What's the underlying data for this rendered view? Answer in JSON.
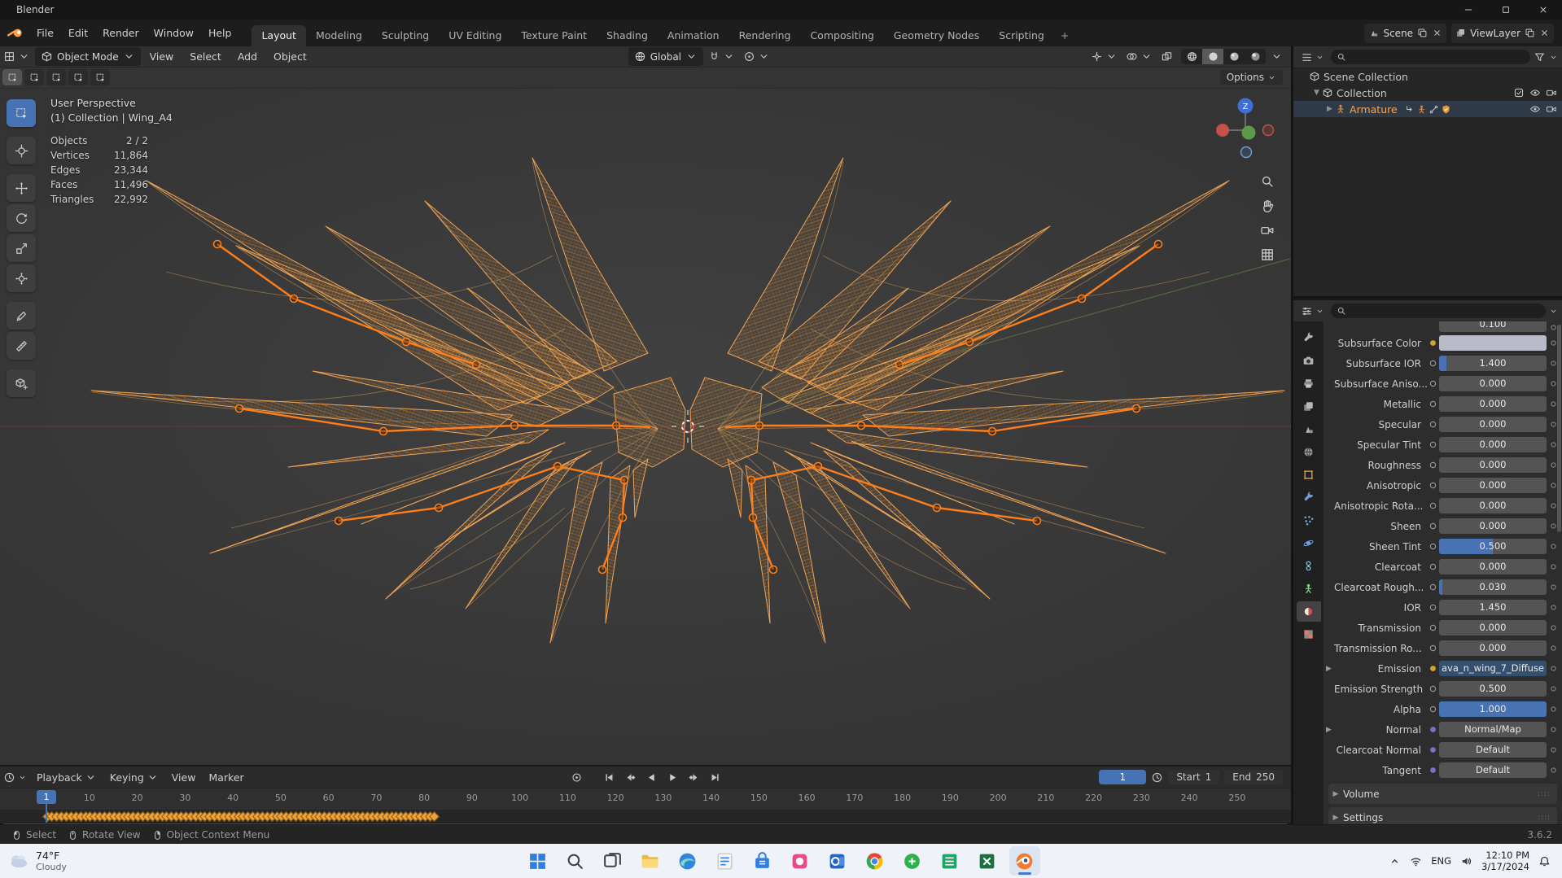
{
  "colors": {
    "accent_blue": "#4772b3",
    "selection_orange": "#e87d0d",
    "wing_orange": "#e8993f",
    "bone_orange": "#ff7e1a",
    "taskbar_bg": "#eff3f9"
  },
  "titlebar": {
    "title": "Blender"
  },
  "topbar": {
    "menus": [
      "File",
      "Edit",
      "Render",
      "Window",
      "Help"
    ],
    "tabs": [
      "Layout",
      "Modeling",
      "Sculpting",
      "UV Editing",
      "Texture Paint",
      "Shading",
      "Animation",
      "Rendering",
      "Compositing",
      "Geometry Nodes",
      "Scripting"
    ],
    "active_tab": "Layout",
    "add_tab": "+",
    "scene": {
      "label": "Scene"
    },
    "viewlayer": {
      "label": "ViewLayer"
    }
  },
  "viewport_header": {
    "mode": "Object Mode",
    "menus": [
      "View",
      "Select",
      "Add",
      "Object"
    ],
    "orientation": "Global"
  },
  "toolstrip": {
    "options_label": "Options"
  },
  "viewport_overlay": {
    "line1": "User Perspective",
    "line2": "(1) Collection | Wing_A4",
    "stats": [
      {
        "label": "Objects",
        "value": "2 / 2"
      },
      {
        "label": "Vertices",
        "value": "11,864"
      },
      {
        "label": "Edges",
        "value": "23,344"
      },
      {
        "label": "Faces",
        "value": "11,496"
      },
      {
        "label": "Triangles",
        "value": "22,992"
      }
    ],
    "gizmo_axis_label": "Z"
  },
  "tools": [
    "select-box",
    "cursor",
    "move",
    "rotate",
    "scale",
    "transform",
    "annotate",
    "measure",
    "add-cube"
  ],
  "outliner": {
    "rows": [
      {
        "label": "Scene Collection",
        "depth": 0,
        "icon": "box",
        "arrow": "",
        "inline": [],
        "right": []
      },
      {
        "label": "Collection",
        "depth": 1,
        "icon": "box",
        "arrow": "down",
        "inline": [],
        "right": [
          "checkbox",
          "eye",
          "camera"
        ]
      },
      {
        "label": "Armature",
        "depth": 2,
        "icon": "armature",
        "arrow": "right",
        "selected": true,
        "inline": [
          "childlink",
          "armature",
          "bone",
          "shield"
        ],
        "right": [
          "eye",
          "camera"
        ]
      }
    ]
  },
  "properties": {
    "partial_value": "0.100",
    "rows": [
      {
        "label": "Subsurface Color",
        "value": "",
        "type": "color",
        "socket": "yellow",
        "fill": 0
      },
      {
        "label": "Subsurface IOR",
        "value": "1.400",
        "type": "slider",
        "socket": "gray",
        "fill": 0.07
      },
      {
        "label": "Subsurface Aniso...",
        "value": "0.000",
        "type": "slider",
        "socket": "gray",
        "fill": 0
      },
      {
        "label": "Metallic",
        "value": "0.000",
        "type": "slider",
        "socket": "gray",
        "fill": 0
      },
      {
        "label": "Specular",
        "value": "0.000",
        "type": "slider",
        "socket": "gray",
        "fill": 0
      },
      {
        "label": "Specular Tint",
        "value": "0.000",
        "type": "slider",
        "socket": "gray",
        "fill": 0
      },
      {
        "label": "Roughness",
        "value": "0.000",
        "type": "slider",
        "socket": "gray",
        "fill": 0
      },
      {
        "label": "Anisotropic",
        "value": "0.000",
        "type": "slider",
        "socket": "gray",
        "fill": 0
      },
      {
        "label": "Anisotropic Rota...",
        "value": "0.000",
        "type": "slider",
        "socket": "gray",
        "fill": 0
      },
      {
        "label": "Sheen",
        "value": "0.000",
        "type": "slider",
        "socket": "gray",
        "fill": 0
      },
      {
        "label": "Sheen Tint",
        "value": "0.500",
        "type": "slider",
        "socket": "gray",
        "fill": 0.5
      },
      {
        "label": "Clearcoat",
        "value": "0.000",
        "type": "slider",
        "socket": "gray",
        "fill": 0
      },
      {
        "label": "Clearcoat Rough...",
        "value": "0.030",
        "type": "slider",
        "socket": "gray",
        "fill": 0.03
      },
      {
        "label": "IOR",
        "value": "1.450",
        "type": "slider",
        "socket": "gray",
        "fill": 0
      },
      {
        "label": "Transmission",
        "value": "0.000",
        "type": "slider",
        "socket": "gray",
        "fill": 0
      },
      {
        "label": "Transmission Ro...",
        "value": "0.000",
        "type": "slider",
        "socket": "gray",
        "fill": 0
      },
      {
        "label": "Emission",
        "value": "ava_n_wing_7_Diffuse",
        "type": "link",
        "socket": "yellow",
        "fill": 0,
        "expander": true
      },
      {
        "label": "Emission Strength",
        "value": "0.500",
        "type": "slider",
        "socket": "gray",
        "fill": 0
      },
      {
        "label": "Alpha",
        "value": "1.000",
        "type": "slider",
        "socket": "gray",
        "fill": 1
      },
      {
        "label": "Normal",
        "value": "Normal/Map",
        "type": "menu",
        "socket": "vector",
        "fill": 0,
        "expander": true
      },
      {
        "label": "Clearcoat Normal",
        "value": "Default",
        "type": "menu",
        "socket": "vector",
        "fill": 0
      },
      {
        "label": "Tangent",
        "value": "Default",
        "type": "menu",
        "socket": "vector",
        "fill": 0
      }
    ],
    "sections": [
      {
        "label": "Volume"
      },
      {
        "label": "Settings"
      }
    ],
    "tabs": [
      "tool",
      "render",
      "output",
      "view-layer",
      "scene",
      "world",
      "object",
      "modifiers",
      "particles",
      "physics",
      "constraints",
      "object-data",
      "material",
      "texture"
    ],
    "active_tab": "material"
  },
  "timeline": {
    "menus": [
      {
        "label": "Playback",
        "chev": true
      },
      {
        "label": "Keying",
        "chev": true
      },
      {
        "label": "View",
        "chev": false
      },
      {
        "label": "Marker",
        "chev": false
      }
    ],
    "current_frame": "1",
    "frame_ticks": [
      10,
      20,
      30,
      40,
      50,
      60,
      70,
      80,
      90,
      100,
      110,
      120,
      130,
      140,
      150,
      160,
      170,
      180,
      190,
      200,
      210,
      220,
      230,
      240,
      250
    ],
    "keyframe_range": {
      "start": 1,
      "end": 82
    },
    "start_label": "Start",
    "start_value": "1",
    "end_label": "End",
    "end_value": "250"
  },
  "statusbar": {
    "hints": [
      {
        "icon": "mouse-left",
        "label": "Select"
      },
      {
        "icon": "mouse-middle",
        "label": "Rotate View"
      },
      {
        "icon": "mouse-right",
        "label": "Object Context Menu"
      }
    ],
    "version": "3.6.2"
  },
  "taskbar": {
    "weather": {
      "temp": "74°F",
      "condition": "Cloudy"
    },
    "icons": [
      "start",
      "search",
      "task-view",
      "file-explorer",
      "edge",
      "app-light",
      "store",
      "app-pink",
      "outlook",
      "chrome",
      "app-green",
      "app-sheets",
      "excel",
      "blender"
    ],
    "active_icon": "blender",
    "tray": {
      "lang": "ENG",
      "time": "12:10 PM",
      "date": "3/17/2024"
    }
  }
}
